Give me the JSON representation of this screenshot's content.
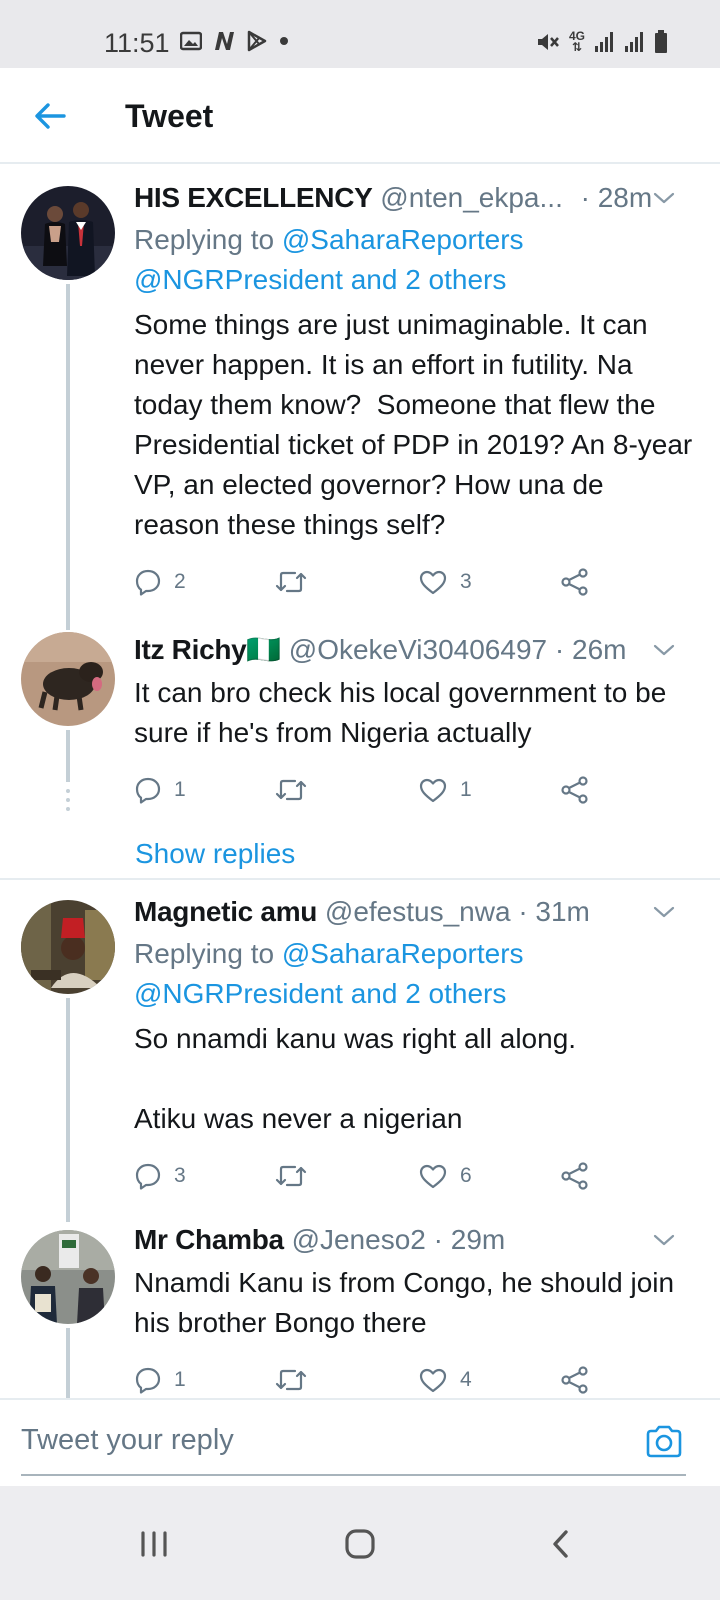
{
  "status_bar": {
    "time": "11:51",
    "network": "4G",
    "icons_left": [
      "image-icon",
      "n-app-icon",
      "play-store-icon",
      "dot-icon"
    ],
    "icons_right": [
      "mute-icon",
      "4g-icon",
      "signal-icon",
      "signal-icon",
      "battery-icon"
    ]
  },
  "header": {
    "title": "Tweet",
    "back_icon": "arrow-left-icon"
  },
  "tweets": [
    {
      "name": "HIS EXCELLENCY",
      "handle": "@nten_ekpa...",
      "time": "· 28m",
      "replying_prefix": "Replying to ",
      "replying_1": "@SaharaReporters",
      "replying_2": "@NGRPresident and 2 others",
      "text": "Some things are just unimaginable. It can never happen. It is an effort in futility. Na today them know?  Someone that flew the Presidential ticket of PDP in 2019? An 8-year VP, an elected governor? How una de reason these things self?",
      "replies": "2",
      "retweets": "",
      "likes": "3"
    },
    {
      "name": "Itz Richy🇳🇬",
      "handle": "@OkekeVi30406497",
      "time": "· 26m",
      "text": "It can bro check his local government to be sure if he's from Nigeria actually",
      "replies": "1",
      "retweets": "",
      "likes": "1",
      "show_replies": "Show replies"
    },
    {
      "name": "Magnetic amu",
      "handle": "@efestus_nwa",
      "time": "· 31m",
      "replying_prefix": "Replying to ",
      "replying_1": "@SaharaReporters",
      "replying_2": "@NGRPresident and 2 others",
      "text": "So nnamdi kanu was right all along.\n\nAtiku was never a nigerian",
      "replies": "3",
      "retweets": "",
      "likes": "6"
    },
    {
      "name": "Mr Chamba",
      "handle": "@Jeneso2",
      "time": "· 29m",
      "text": "Nnamdi Kanu is from Congo, he should join his brother Bongo there",
      "replies": "1",
      "retweets": "",
      "likes": "4"
    }
  ],
  "composer": {
    "placeholder": "Tweet your reply",
    "camera_icon": "camera-icon"
  },
  "colors": {
    "accent": "#1b95e0",
    "secondary_text": "#657786",
    "primary_text": "#14171a",
    "divider": "#e6ecf0"
  }
}
